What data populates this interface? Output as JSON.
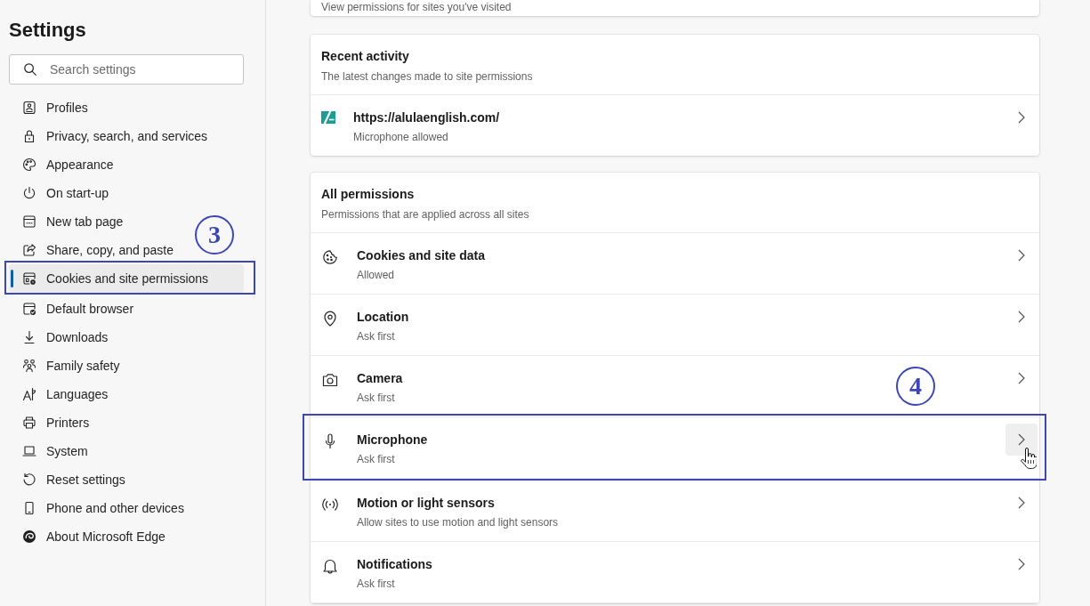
{
  "sidebar": {
    "title": "Settings",
    "search": {
      "placeholder": "Search settings"
    },
    "items": [
      {
        "label": "Profiles",
        "selected": false,
        "framed": false
      },
      {
        "label": "Privacy, search, and services",
        "selected": false,
        "framed": false
      },
      {
        "label": "Appearance",
        "selected": false,
        "framed": false
      },
      {
        "label": "On start-up",
        "selected": false,
        "framed": false
      },
      {
        "label": "New tab page",
        "selected": false,
        "framed": false
      },
      {
        "label": "Share, copy, and paste",
        "selected": false,
        "framed": false
      },
      {
        "label": "Cookies and site permissions",
        "selected": true,
        "framed": true,
        "callout": "3"
      },
      {
        "label": "Default browser",
        "selected": false,
        "framed": false
      },
      {
        "label": "Downloads",
        "selected": false,
        "framed": false
      },
      {
        "label": "Family safety",
        "selected": false,
        "framed": false
      },
      {
        "label": "Languages",
        "selected": false,
        "framed": false
      },
      {
        "label": "Printers",
        "selected": false,
        "framed": false
      },
      {
        "label": "System",
        "selected": false,
        "framed": false
      },
      {
        "label": "Reset settings",
        "selected": false,
        "framed": false
      },
      {
        "label": "Phone and other devices",
        "selected": false,
        "framed": false
      },
      {
        "label": "About Microsoft Edge",
        "selected": false,
        "framed": false
      }
    ]
  },
  "site_permissions": {
    "subtitle": "View permissions for sites you've visited"
  },
  "recent_activity": {
    "title": "Recent activity",
    "subtitle": "The latest changes made to site permissions",
    "sites": [
      {
        "url": "https://alulaenglish.com/",
        "status": "Microphone allowed"
      }
    ]
  },
  "all_permissions": {
    "title": "All permissions",
    "subtitle": "Permissions that are applied across all sites",
    "rows": [
      {
        "title": "Cookies and site data",
        "status": "Allowed",
        "hovered": false,
        "framed": false
      },
      {
        "title": "Location",
        "status": "Ask first",
        "hovered": false,
        "framed": false
      },
      {
        "title": "Camera",
        "status": "Ask first",
        "hovered": false,
        "framed": false
      },
      {
        "title": "Microphone",
        "status": "Ask first",
        "hovered": true,
        "framed": true,
        "callout": "4"
      },
      {
        "title": "Motion or light sensors",
        "status": "Allow sites to use motion and light sensors",
        "hovered": false,
        "framed": false
      },
      {
        "title": "Notifications",
        "status": "Ask first",
        "hovered": false,
        "framed": false
      }
    ]
  }
}
